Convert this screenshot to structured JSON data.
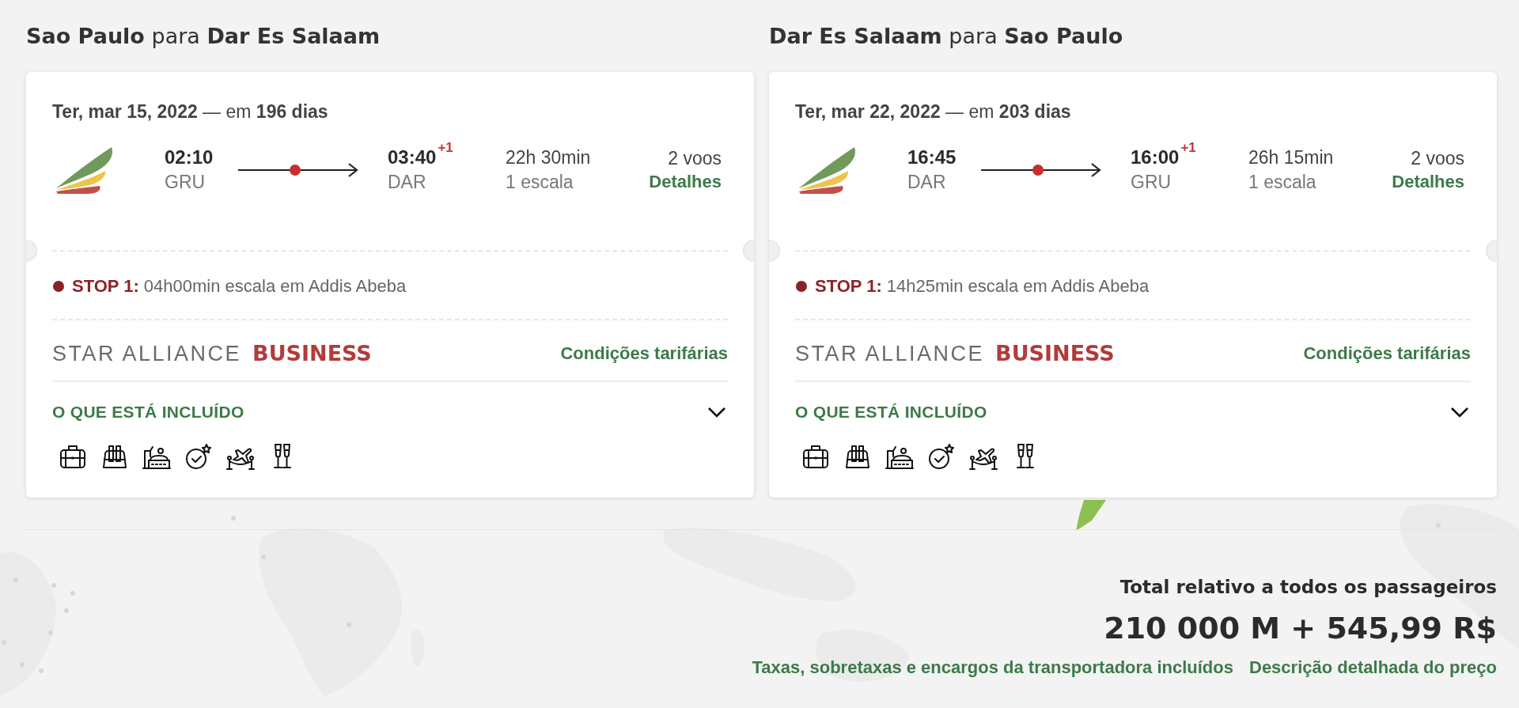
{
  "itineraries": [
    {
      "title": "**Sao Paulo** para **Dar Es Salaam**",
      "date": "**Ter, mar 15, 2022** — em **196 dias**",
      "flight": {
        "departure_time": "02:10",
        "departure_airport": "GRU",
        "arrival_time": "03:40",
        "day_offset": "+1",
        "arrival_airport": "DAR",
        "duration": "22h 30min",
        "stops": "1 escala",
        "flights": "2 voos",
        "details_link": "Detalhes"
      },
      "layovers": [
        {
          "label": "STOP 1:",
          "text": "04h00min escala em Addis Abeba"
        }
      ],
      "fare": {
        "alliance": "STAR ALLIANCE",
        "cabin": "BUSINESS",
        "conditions_link": "Condições tarifárias"
      },
      "included": {
        "title": "O QUE ESTÁ INCLUÍDO",
        "expanded": false
      }
    },
    {
      "title": "**Dar Es Salaam** para **Sao Paulo**",
      "date": "**Ter, mar 22, 2022** — em **203 dias**",
      "flight": {
        "departure_time": "16:45",
        "departure_airport": "DAR",
        "arrival_time": "16:00",
        "day_offset": "+1",
        "arrival_airport": "GRU",
        "duration": "26h 15min",
        "stops": "1 escala",
        "flights": "2 voos",
        "details_link": "Detalhes"
      },
      "layovers": [
        {
          "label": "STOP 1:",
          "text": "14h25min escala em Addis Abeba"
        }
      ],
      "fare": {
        "alliance": "STAR ALLIANCE",
        "cabin": "BUSINESS",
        "conditions_link": "Condições tarifárias"
      },
      "included": {
        "title": "O QUE ESTÁ INCLUÍDO",
        "expanded": false
      }
    }
  ],
  "total": {
    "label": "Total relativo a todos os passageiros",
    "amount": "210 000 M + 545,99 R$",
    "note": "Taxas, sobretaxas e encargos da transportadora incluídos",
    "breakdown_link": "Descrição detalhada do preço"
  }
}
